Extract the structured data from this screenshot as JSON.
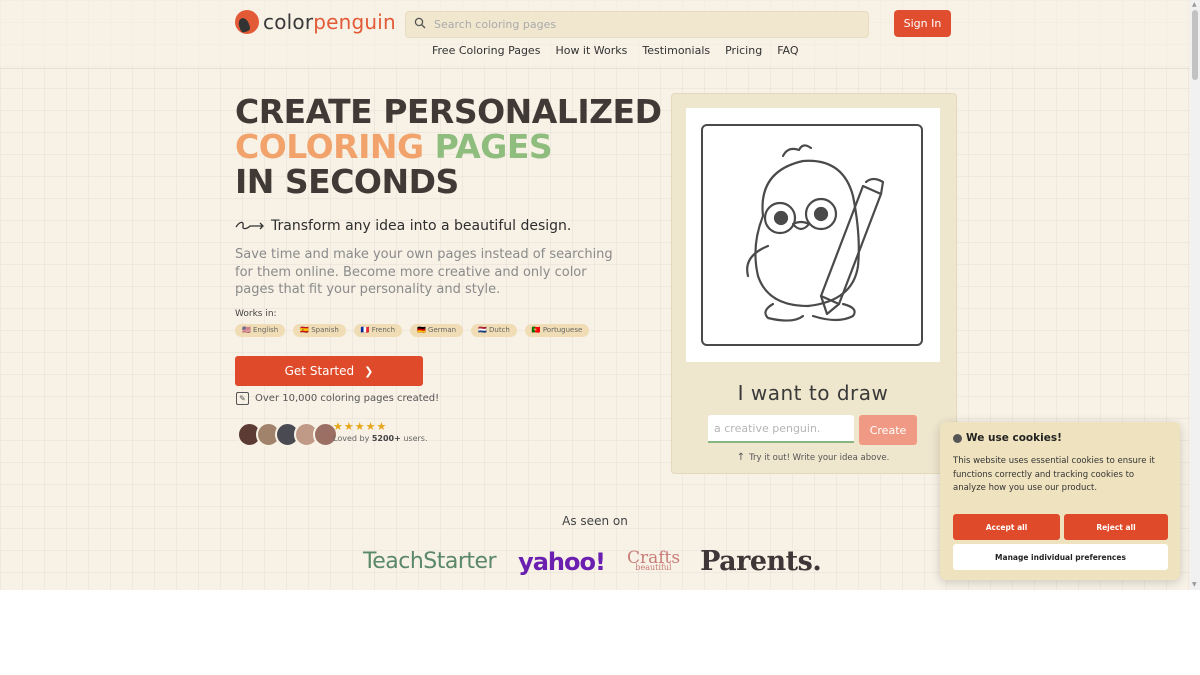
{
  "brand": {
    "name_part1": "color",
    "name_part2": "penguin",
    "accent": "#e04e2f"
  },
  "search": {
    "placeholder": "Search coloring pages",
    "value": ""
  },
  "header": {
    "signin_label": "Sign In"
  },
  "nav": [
    "Free Coloring Pages",
    "How it Works",
    "Testimonials",
    "Pricing",
    "FAQ"
  ],
  "hero": {
    "title_line1": "Create personalized",
    "title_line2_a": "Coloring",
    "title_line2_b": "pages",
    "title_line3": "in seconds",
    "tagline": "Transform any idea into a beautiful design.",
    "description": "Save time and make your own pages instead of searching for them online. Become more creative and only color pages that fit your personality and style.",
    "works_in_label": "Works in:",
    "languages": [
      {
        "flag": "🇺🇸",
        "label": "English"
      },
      {
        "flag": "🇪🇸",
        "label": "Spanish"
      },
      {
        "flag": "🇫🇷",
        "label": "French"
      },
      {
        "flag": "🇩🇪",
        "label": "German"
      },
      {
        "flag": "🇳🇱",
        "label": "Dutch"
      },
      {
        "flag": "🇵🇹",
        "label": "Portuguese"
      }
    ],
    "cta_label": "Get Started",
    "created_text": "Over 10,000 coloring pages created!",
    "stars": "★★★★★",
    "loved_prefix": "Loved by ",
    "loved_count": "5200+",
    "loved_suffix": " users."
  },
  "draw": {
    "title": "I want to draw",
    "input_placeholder": "a creative penguin.",
    "input_value": "",
    "create_label": "Create",
    "hint": "Try it out! Write your idea above."
  },
  "seen_on": {
    "heading": "As seen on",
    "logos": {
      "teach": "TeachStarter",
      "yahoo": "yahoo!",
      "crafts": "Crafts",
      "crafts_sub": "beautiful",
      "parents": "Parents."
    }
  },
  "cookie": {
    "title": "We use cookies!",
    "text": "This website uses essential cookies to ensure it functions correctly and tracking cookies to analyze how you use our product.",
    "accept": "Accept all",
    "reject": "Reject all",
    "manage": "Manage individual preferences"
  }
}
